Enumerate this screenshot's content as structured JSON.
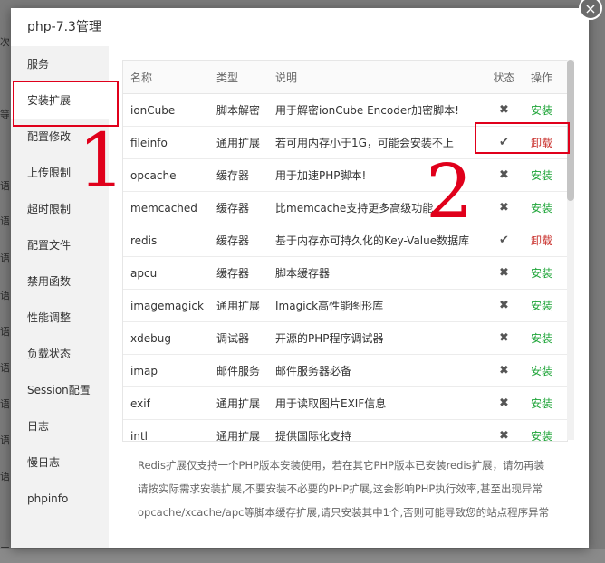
{
  "background_fragments": [
    "次",
    "等",
    "语",
    "语",
    "语",
    "语",
    "语",
    "语",
    "语",
    "语",
    "语",
    "工费"
  ],
  "dialog": {
    "title": "php-7.3管理",
    "close_icon": "×"
  },
  "sidebar": {
    "items": [
      {
        "label": "服务"
      },
      {
        "label": "安装扩展"
      },
      {
        "label": "配置修改"
      },
      {
        "label": "上传限制"
      },
      {
        "label": "超时限制"
      },
      {
        "label": "配置文件"
      },
      {
        "label": "禁用函数"
      },
      {
        "label": "性能调整"
      },
      {
        "label": "负载状态"
      },
      {
        "label": "Session配置"
      },
      {
        "label": "日志"
      },
      {
        "label": "慢日志"
      },
      {
        "label": "phpinfo"
      }
    ],
    "active_index": 1
  },
  "table": {
    "headers": {
      "name": "名称",
      "type": "类型",
      "desc": "说明",
      "status": "状态",
      "op": "操作"
    },
    "rows": [
      {
        "name": "ionCube",
        "type": "脚本解密",
        "desc": "用于解密ionCube Encoder加密脚本!",
        "status": "✖",
        "op": "安装"
      },
      {
        "name": "fileinfo",
        "type": "通用扩展",
        "desc": "若可用内存小于1G，可能会安装不上",
        "status": "✔",
        "op": "卸载"
      },
      {
        "name": "opcache",
        "type": "缓存器",
        "desc": "用于加速PHP脚本!",
        "status": "✖",
        "op": "安装"
      },
      {
        "name": "memcached",
        "type": "缓存器",
        "desc": "比memcache支持更多高级功能",
        "status": "✖",
        "op": "安装"
      },
      {
        "name": "redis",
        "type": "缓存器",
        "desc": "基于内存亦可持久化的Key-Value数据库",
        "status": "✔",
        "op": "卸载"
      },
      {
        "name": "apcu",
        "type": "缓存器",
        "desc": "脚本缓存器",
        "status": "✖",
        "op": "安装"
      },
      {
        "name": "imagemagick",
        "type": "通用扩展",
        "desc": "Imagick高性能图形库",
        "status": "✖",
        "op": "安装"
      },
      {
        "name": "xdebug",
        "type": "调试器",
        "desc": "开源的PHP程序调试器",
        "status": "✖",
        "op": "安装"
      },
      {
        "name": "imap",
        "type": "邮件服务",
        "desc": "邮件服务器必备",
        "status": "✖",
        "op": "安装"
      },
      {
        "name": "exif",
        "type": "通用扩展",
        "desc": "用于读取图片EXIF信息",
        "status": "✖",
        "op": "安装"
      },
      {
        "name": "intl",
        "type": "通用扩展",
        "desc": "提供国际化支持",
        "status": "✖",
        "op": "安装"
      }
    ]
  },
  "notes": [
    "Redis扩展仅支持一个PHP版本安装使用，若在其它PHP版本已安装redis扩展，请勿再装",
    "请按实际需求安装扩展,不要安装不必要的PHP扩展,这会影响PHP执行效率,甚至出现异常",
    "opcache/xcache/apc等脚本缓存扩展,请只安装其中1个,否则可能导致您的站点程序异常"
  ],
  "annotations": {
    "one": "1",
    "two": "2"
  },
  "colors": {
    "install": "#20a53a",
    "uninstall": "#c9302c",
    "annotation": "#e0001b"
  }
}
